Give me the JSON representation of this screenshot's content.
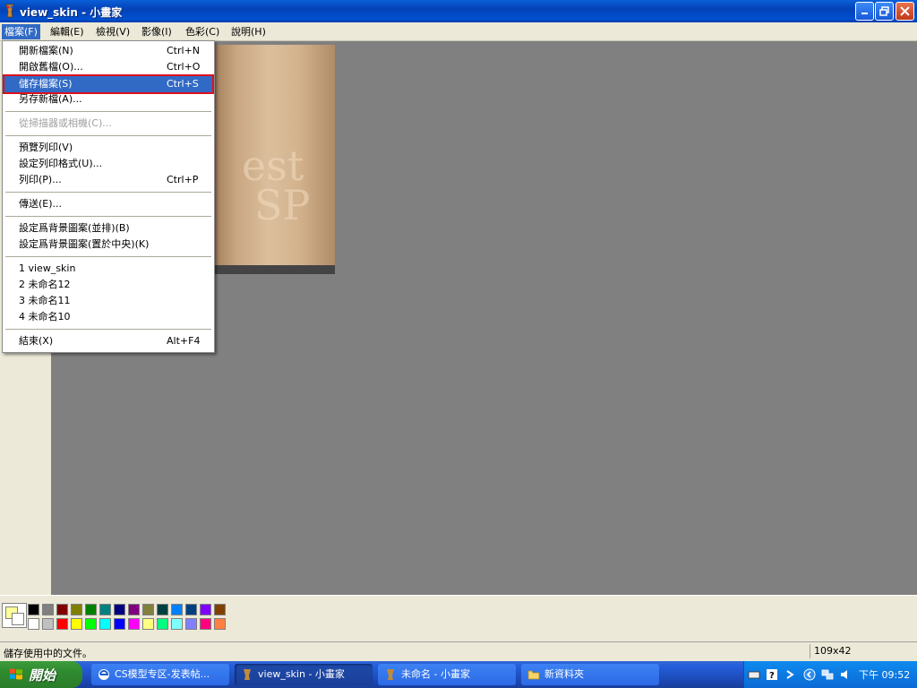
{
  "window": {
    "title": "view_skin - 小畫家"
  },
  "menubar": [
    {
      "label": "檔案(F)",
      "open": true
    },
    {
      "label": "編輯(E)"
    },
    {
      "label": "檢視(V)"
    },
    {
      "label": "影像(I)"
    },
    {
      "label": "色彩(C)"
    },
    {
      "label": "說明(H)"
    }
  ],
  "file_menu": {
    "new": {
      "label": "開新檔案(N)",
      "shortcut": "Ctrl+N"
    },
    "open": {
      "label": "開啟舊檔(O)...",
      "shortcut": "Ctrl+O"
    },
    "save": {
      "label": "儲存檔案(S)",
      "shortcut": "Ctrl+S",
      "highlighted": true
    },
    "save_as": {
      "label": "另存新檔(A)..."
    },
    "scanner": {
      "label": "從掃描器或相機(C)...",
      "disabled": true
    },
    "print_preview": {
      "label": "預覽列印(V)"
    },
    "page_setup": {
      "label": "設定列印格式(U)..."
    },
    "print": {
      "label": "列印(P)...",
      "shortcut": "Ctrl+P"
    },
    "send": {
      "label": "傳送(E)..."
    },
    "bg_tile": {
      "label": "設定爲背景圖案(並排)(B)"
    },
    "bg_center": {
      "label": "設定爲背景圖案(置於中央)(K)"
    },
    "recent": [
      "1 view_skin",
      "2 未命名12",
      "3 未命名11",
      "4 未命名10"
    ],
    "exit": {
      "label": "結束(X)",
      "shortcut": "Alt+F4"
    }
  },
  "image_text": {
    "line1": "est",
    "line2": "SP"
  },
  "palette": {
    "primary": "#ffff99",
    "top_row": [
      "#000000",
      "#808080",
      "#800000",
      "#808000",
      "#008000",
      "#008080",
      "#000080",
      "#800080",
      "#808040",
      "#004040",
      "#0080ff",
      "#004080",
      "#8000ff",
      "#804000"
    ],
    "bottom_row": [
      "#ffffff",
      "#c0c0c0",
      "#ff0000",
      "#ffff00",
      "#00ff00",
      "#00ffff",
      "#0000ff",
      "#ff00ff",
      "#ffff80",
      "#00ff80",
      "#80ffff",
      "#8080ff",
      "#ff0080",
      "#ff8040"
    ]
  },
  "status": {
    "text": "儲存使用中的文件。",
    "size": "109x42"
  },
  "taskbar": {
    "start_label": "開始",
    "tasks": [
      {
        "label": "CS模型专区-发表帖..."
      },
      {
        "label": "view_skin - 小畫家",
        "active": true
      },
      {
        "label": "未命名 - 小畫家"
      },
      {
        "label": "新資料夾"
      }
    ],
    "clock": "下午 09:52"
  }
}
